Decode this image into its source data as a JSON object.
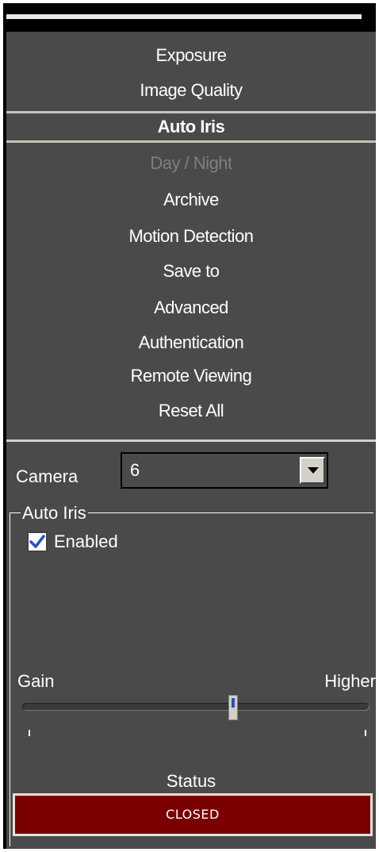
{
  "menu": {
    "items": [
      {
        "label": "Exposure",
        "state": "normal"
      },
      {
        "label": "Image Quality",
        "state": "normal"
      },
      {
        "label": "Auto Iris",
        "state": "selected"
      },
      {
        "label": "Day / Night",
        "state": "disabled"
      },
      {
        "label": "Archive",
        "state": "normal"
      },
      {
        "label": "Motion Detection",
        "state": "normal"
      },
      {
        "label": "Save to",
        "state": "normal"
      },
      {
        "label": "Advanced",
        "state": "normal"
      },
      {
        "label": "Authentication",
        "state": "normal"
      },
      {
        "label": "Remote Viewing",
        "state": "normal"
      },
      {
        "label": "Reset All",
        "state": "normal"
      }
    ]
  },
  "camera": {
    "label": "Camera",
    "value": "6"
  },
  "auto_iris": {
    "group_title": "Auto Iris",
    "enabled_label": "Enabled",
    "enabled": true,
    "gain_label": "Gain",
    "higher_label": "Higher",
    "gain_level": 0.61
  },
  "status": {
    "label": "Status",
    "value": "CLOSED",
    "color": "#7a0000"
  },
  "colors": {
    "panel": "#4a4a4a",
    "text": "#ffffff",
    "disabled": "#7e7e7e",
    "accent": "#2850c8"
  }
}
